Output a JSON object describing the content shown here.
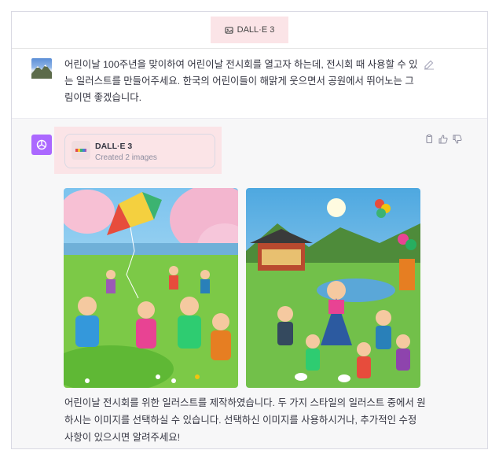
{
  "header": {
    "model_label": "DALL·E 3"
  },
  "user_message": {
    "text": "어린이날 100주년을 맞이하여 어린이날 전시회를 열고자 하는데, 전시회 때 사용할 수 있는 일러스트를 만들어주세요. 한국의 어린이들이 해맑게 웃으면서 공원에서 뛰어노는 그림이면 좋겠습니다."
  },
  "tool": {
    "title": "DALL·E 3",
    "subtitle": "Created 2 images"
  },
  "assistant_message": {
    "text": "어린이날 전시회를 위한 일러스트를 제작하였습니다. 두 가지 스타일의 일러스트 중에서 원하시는 이미지를 선택하실 수 있습니다. 선택하신 이미지를 사용하시거나, 추가적인 수정 사항이 있으시면 알려주세요!"
  },
  "icons": {
    "model": "image-icon",
    "edit": "edit-icon",
    "copy": "copy-icon",
    "thumbs_up": "thumbs-up-icon",
    "thumbs_down": "thumbs-down-icon",
    "assistant_avatar": "openai-logo-icon"
  },
  "colors": {
    "highlight": "#fbe4e7",
    "assistant_avatar": "#ab68ff"
  }
}
